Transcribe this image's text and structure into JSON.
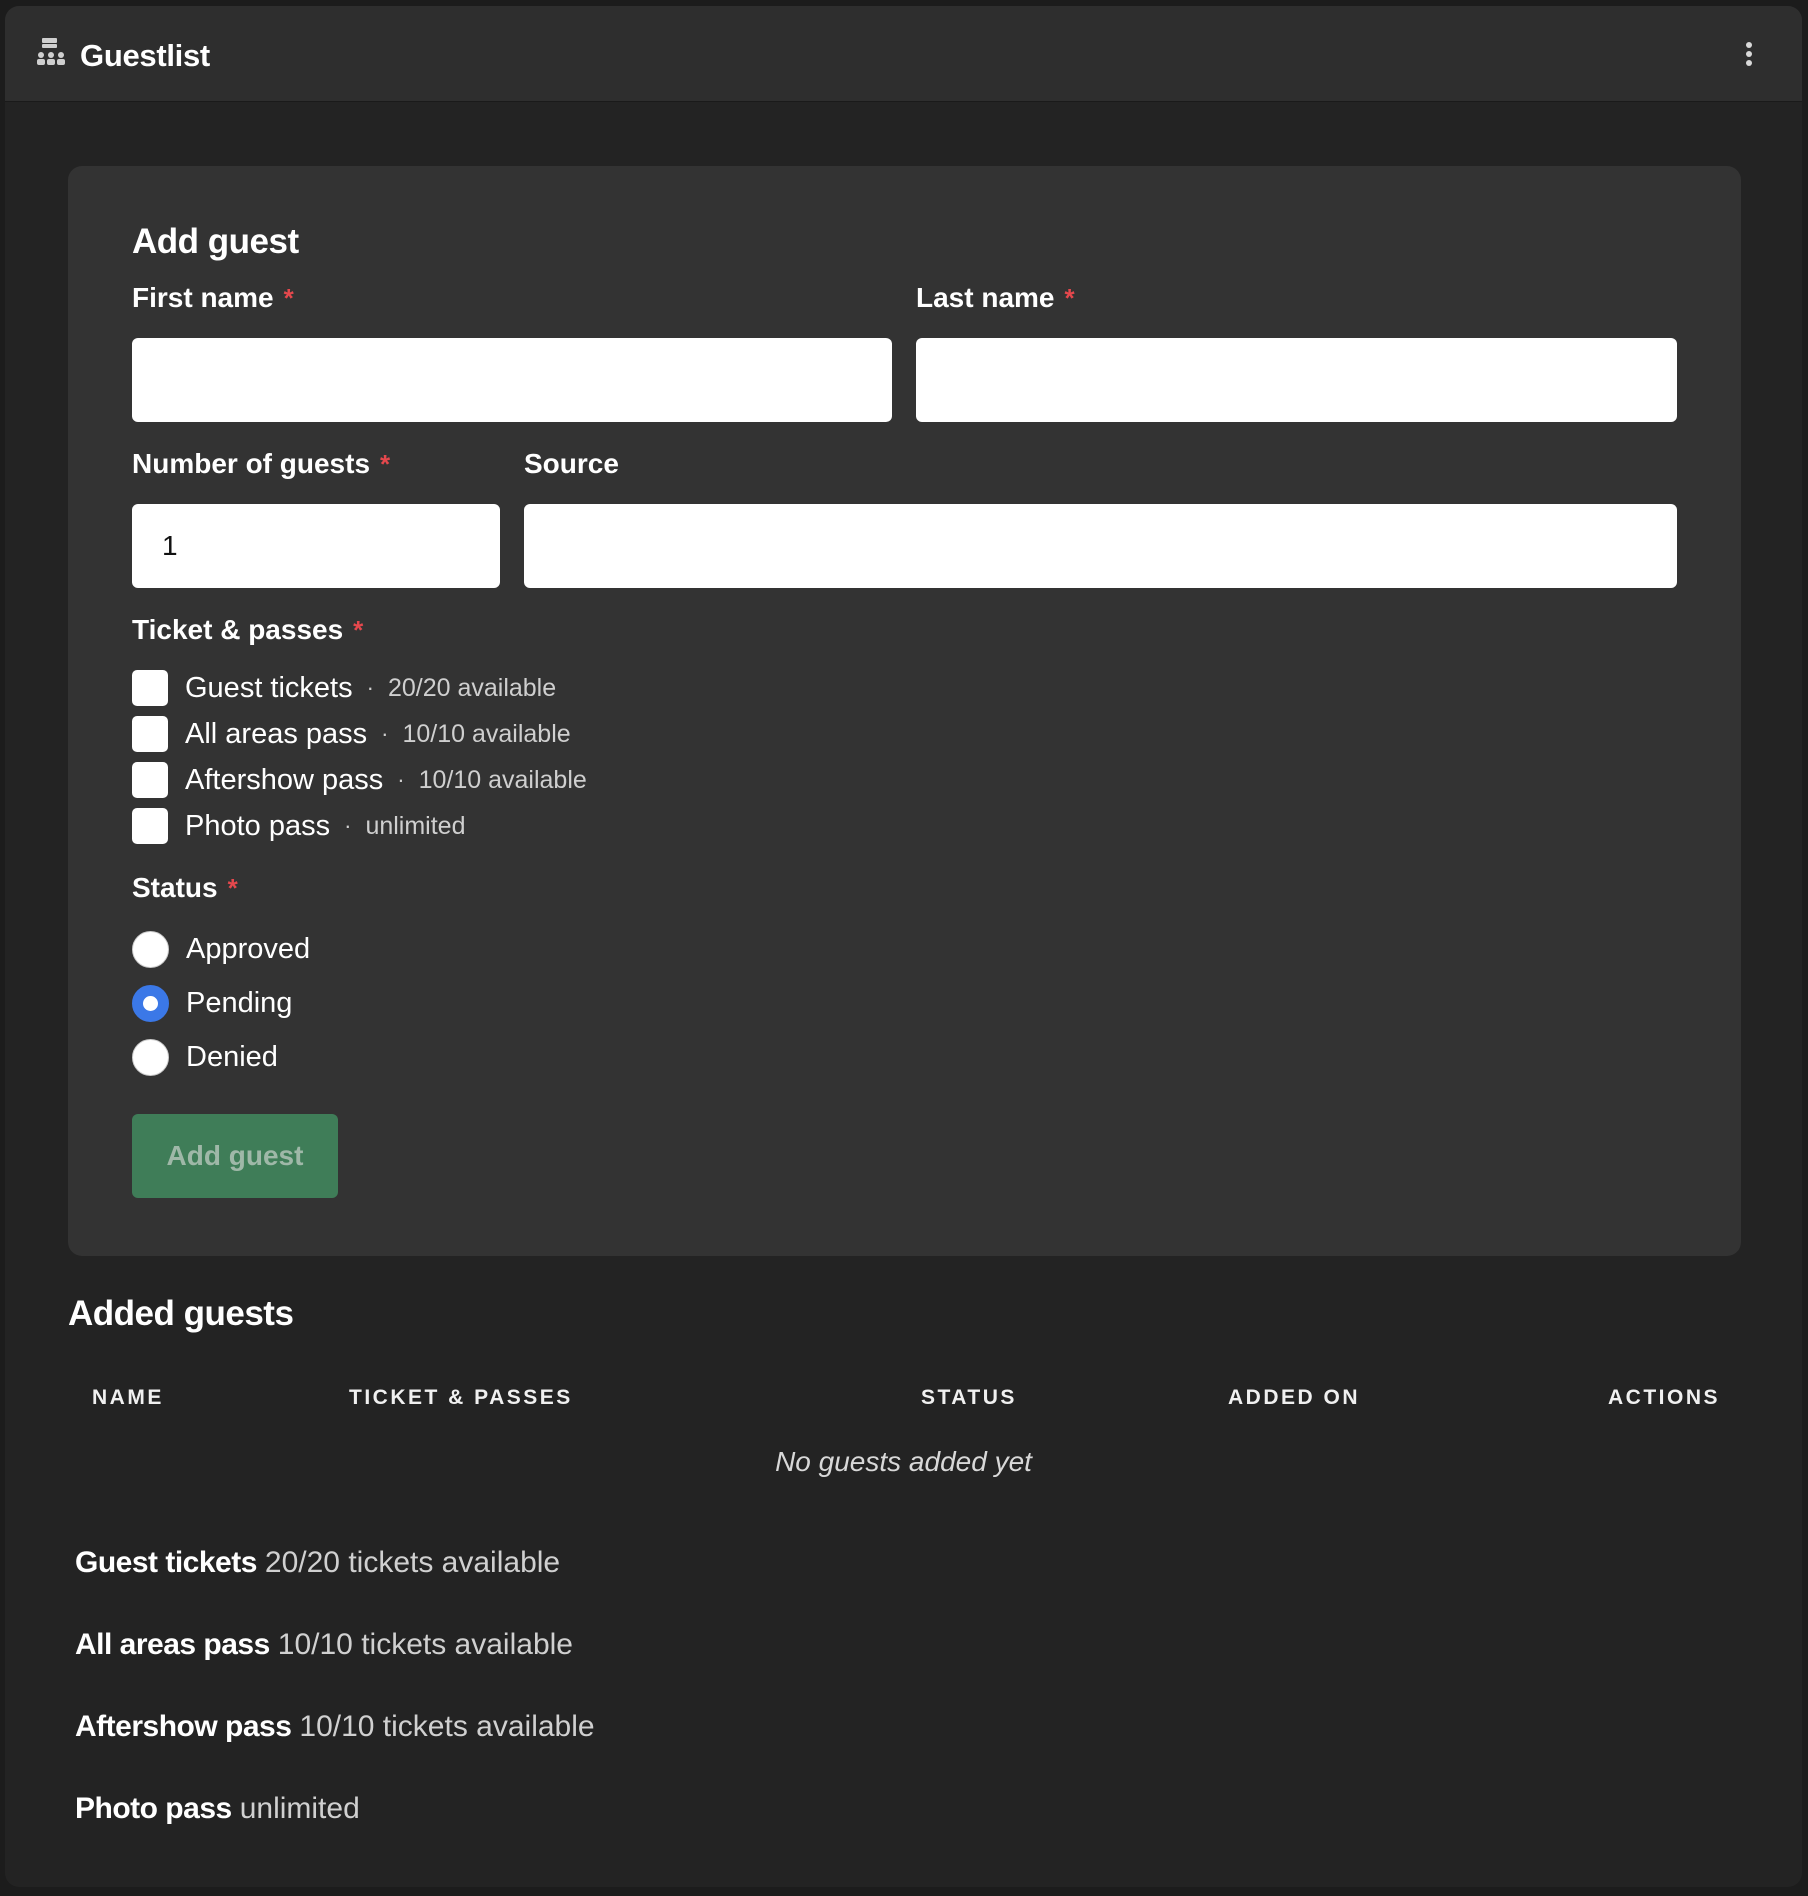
{
  "header": {
    "title": "Guestlist",
    "icon": "guestlist-icon",
    "menu_icon": "kebab-menu-icon"
  },
  "form": {
    "title": "Add guest",
    "first_name": {
      "label": "First name",
      "required": "*",
      "value": ""
    },
    "last_name": {
      "label": "Last name",
      "required": "*",
      "value": ""
    },
    "num_guests": {
      "label": "Number of guests",
      "required": "*",
      "value": "1"
    },
    "source": {
      "label": "Source",
      "value": ""
    },
    "tickets": {
      "label": "Ticket & passes",
      "required": "*",
      "items": [
        {
          "label": "Guest tickets",
          "sep": "·",
          "meta": "20/20 available",
          "checked": false
        },
        {
          "label": "All areas pass",
          "sep": "·",
          "meta": "10/10 available",
          "checked": false
        },
        {
          "label": "Aftershow pass",
          "sep": "·",
          "meta": "10/10 available",
          "checked": false
        },
        {
          "label": "Photo pass",
          "sep": "·",
          "meta": "unlimited",
          "checked": false
        }
      ]
    },
    "status": {
      "label": "Status",
      "required": "*",
      "options": [
        {
          "label": "Approved",
          "checked": false
        },
        {
          "label": "Pending",
          "checked": true
        },
        {
          "label": "Denied",
          "checked": false
        }
      ]
    },
    "submit_label": "Add guest"
  },
  "guests": {
    "title": "Added guests",
    "columns": [
      "NAME",
      "TICKET & PASSES",
      "STATUS",
      "ADDED ON",
      "ACTIONS"
    ],
    "empty_text": "No guests added yet"
  },
  "summary": [
    {
      "name": "Guest tickets",
      "detail": "20/20 tickets available"
    },
    {
      "name": "All areas pass",
      "detail": "10/10 tickets available"
    },
    {
      "name": "Aftershow pass",
      "detail": "10/10 tickets available"
    },
    {
      "name": "Photo pass",
      "detail": "unlimited"
    }
  ],
  "colors": {
    "accent": "#3b78e7",
    "button": "#3f7d58",
    "required": "#e5484d",
    "card": "#333333",
    "background": "#232323"
  }
}
